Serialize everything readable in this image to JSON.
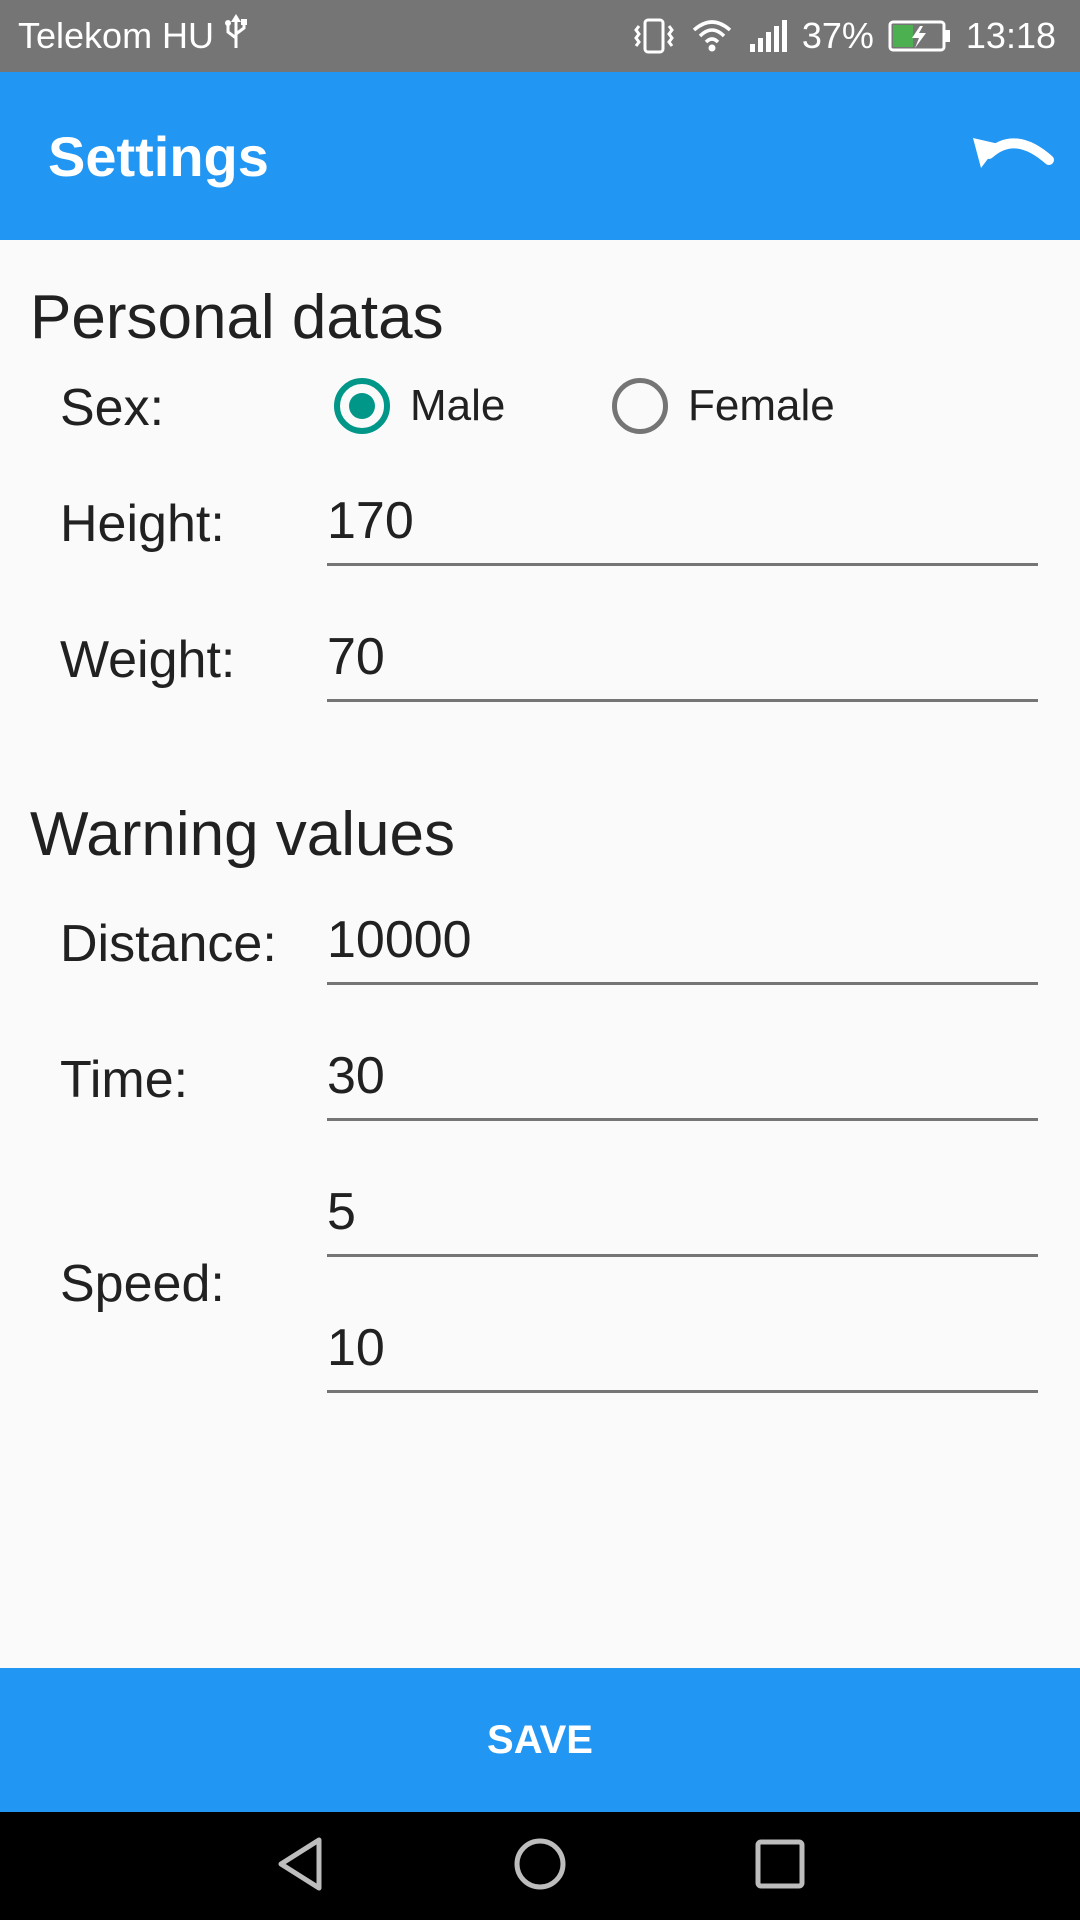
{
  "status_bar": {
    "carrier": "Telekom HU",
    "battery_percent": "37%",
    "time": "13:18",
    "icons": [
      "usb-icon",
      "vibrate-icon",
      "wifi-icon",
      "signal-icon",
      "battery-charging-icon"
    ]
  },
  "app_bar": {
    "title": "Settings",
    "undo_icon": "undo-icon"
  },
  "personal": {
    "title": "Personal datas",
    "sex_label": "Sex:",
    "sex_options": [
      "Male",
      "Female"
    ],
    "sex_selected": "Male",
    "height_label": "Height:",
    "height_value": "170",
    "weight_label": "Weight:",
    "weight_value": "70"
  },
  "warnings": {
    "title": "Warning values",
    "distance_label": "Distance:",
    "distance_value": "10000",
    "time_label": "Time:",
    "time_value": "30",
    "speed_label": "Speed:",
    "speed_value_1": "5",
    "speed_value_2": "10"
  },
  "save_label": "SAVE",
  "nav_bar": {
    "icons": [
      "back-icon",
      "home-icon",
      "recents-icon"
    ]
  },
  "colors": {
    "primary": "#2196f3",
    "accent": "#009688",
    "status_bar": "#757575",
    "background": "#fafafa"
  }
}
